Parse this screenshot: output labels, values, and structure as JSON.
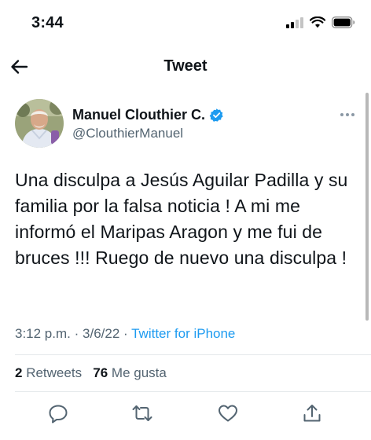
{
  "status_bar": {
    "time": "3:44"
  },
  "header": {
    "title": "Tweet"
  },
  "author": {
    "name": "Manuel Clouthier C.",
    "handle": "@ClouthierManuel",
    "verified": true
  },
  "tweet": {
    "text": "Una disculpa a Jesús Aguilar Padilla y su familia por la falsa noticia ! A mi me informó el Maripas Aragon y me fui de bruces !!! Ruego de nuevo una disculpa !",
    "time": "3:12 p.m.",
    "date": "3/6/22",
    "separator": "·",
    "source": "Twitter for iPhone"
  },
  "stats": {
    "retweets_count": "2",
    "retweets_label": "Retweets",
    "likes_count": "76",
    "likes_label": "Me gusta"
  },
  "actions": [
    "reply-icon",
    "retweet-icon",
    "like-icon",
    "share-icon"
  ],
  "colors": {
    "accent": "#1d9bf0",
    "secondary_text": "#536471",
    "primary_text": "#0f1419"
  }
}
